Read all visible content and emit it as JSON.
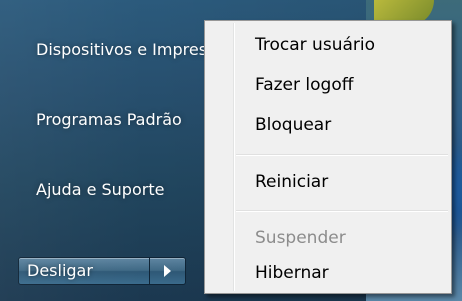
{
  "start_menu": {
    "items": [
      {
        "label": "Dispositivos e Impressoras"
      },
      {
        "label": "Programas Padrão"
      },
      {
        "label": "Ajuda e Suporte"
      }
    ],
    "shutdown_label": "Desligar"
  },
  "context_menu": {
    "items": [
      {
        "label": "Trocar usuário",
        "enabled": true
      },
      {
        "label": "Fazer logoff",
        "enabled": true
      },
      {
        "label": "Bloquear",
        "enabled": true
      },
      {
        "label": "Reiniciar",
        "enabled": true
      },
      {
        "label": "Suspender",
        "enabled": false
      },
      {
        "label": "Hibernar",
        "enabled": true
      }
    ]
  },
  "colors": {
    "start_pane": "#274f6e",
    "menu_background": "#f0f0f0",
    "disabled_text": "#8c8c8c"
  }
}
